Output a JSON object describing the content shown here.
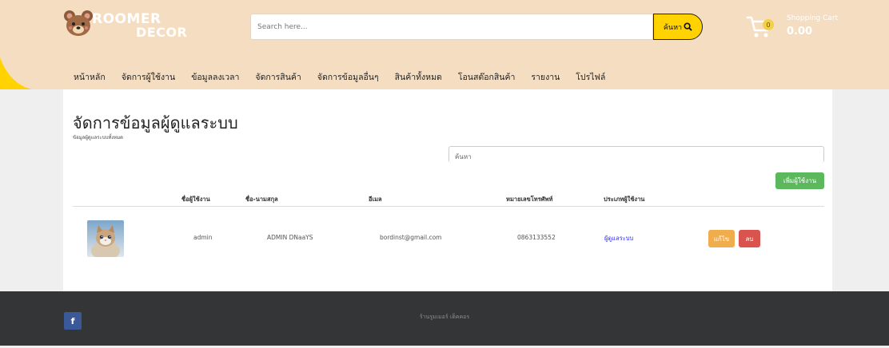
{
  "header": {
    "logo_line1": "ROOMER",
    "logo_line2": "DECOR",
    "search_placeholder": "Search here...",
    "search_button": "ค้นหา",
    "cart_count": "0",
    "cart_label": "Shopping Cart",
    "cart_total": "0.00"
  },
  "nav": {
    "items": [
      "หน้าหลัก",
      "จัดการผู้ใช้งาน",
      "ข้อมูลลงเวลา",
      "จัดการสินค้า",
      "จัดการข้อมูลอื่นๆ",
      "สินค้าทั้งหมด",
      "โอนสต๊อกสินค้า",
      "รายงาน",
      "โปรไฟล์"
    ]
  },
  "page": {
    "title": "จัดการข้อมูลผู้ดูแลระบบ",
    "subtitle": "ข้อมูลผู้ดูแลระบบทั้งหมด",
    "filter_placeholder": "ค้นหา",
    "add_button": "เพิ่มผู้ใช้งาน"
  },
  "table": {
    "headers": [
      "ชื่อผู้ใช้งาน",
      "ชื่อ-นามสกุล",
      "อีเมล",
      "หมายเลขโทรศัพท์",
      "ประเภทผู้ใช้งาน"
    ],
    "rows": [
      {
        "username": "admin",
        "fullname": "ADMIN DNaaYS",
        "email": "bordinst@gmail.com",
        "phone": "0863133552",
        "role": "ผู้ดูแลระบบ",
        "edit_label": "แก้ไข",
        "delete_label": "ลบ"
      }
    ]
  },
  "footer": {
    "facebook_icon": "f",
    "copyright": "ร้านรูมเมอร์ เด็คคอร"
  },
  "colors": {
    "header_bg": "#f5ddc1",
    "search_button": "#ffd200",
    "add_button": "#5cb85c",
    "edit_button": "#f0ad4e",
    "delete_button": "#d9534f",
    "footer_bg": "#333537",
    "role_text": "#2a2aff"
  }
}
